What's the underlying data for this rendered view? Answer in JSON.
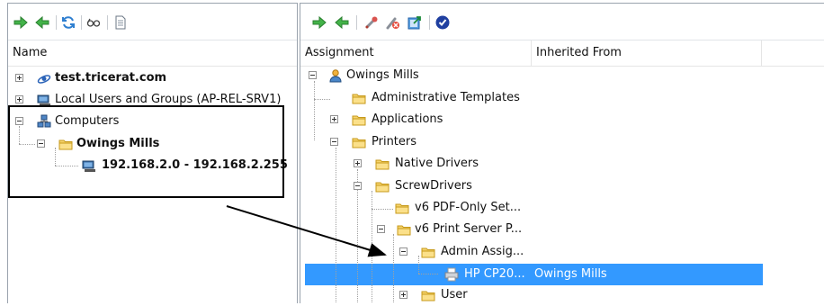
{
  "left": {
    "header": "Name",
    "tree": {
      "server": "test.tricerat.com",
      "local_users": "Local Users and Groups (AP-REL-SRV1)",
      "computers": "Computers",
      "owings": "Owings Mills",
      "ip_range": "192.168.2.0 - 192.168.2.255"
    },
    "toolbar_icons": [
      "arrow-right-icon",
      "arrow-left-icon",
      "refresh-icon",
      "glasses-icon",
      "document-icon"
    ]
  },
  "right": {
    "headers": {
      "assignment": "Assignment",
      "inherited_from": "Inherited From"
    },
    "tree": {
      "root": "Owings Mills",
      "admin_templates": "Administrative Templates",
      "applications": "Applications",
      "printers": "Printers",
      "native_drivers": "Native Drivers",
      "screwdrivers": "ScrewDrivers",
      "v6_pdf": "v6 PDF-Only Set...",
      "v6_print": "v6 Print Server P...",
      "admin_assig": "Admin Assig...",
      "hp": "HP CP20...",
      "hp_inherited": "Owings Mills",
      "user": "User"
    },
    "toolbar_icons": [
      "arrow-right-icon",
      "arrow-left-icon",
      "wrench-icon",
      "delete-icon",
      "export-icon",
      "checkmark-icon"
    ]
  },
  "colors": {
    "selection": "#3399ff",
    "arrow_green": "#3ca83c",
    "folder": "#f2c94c"
  }
}
